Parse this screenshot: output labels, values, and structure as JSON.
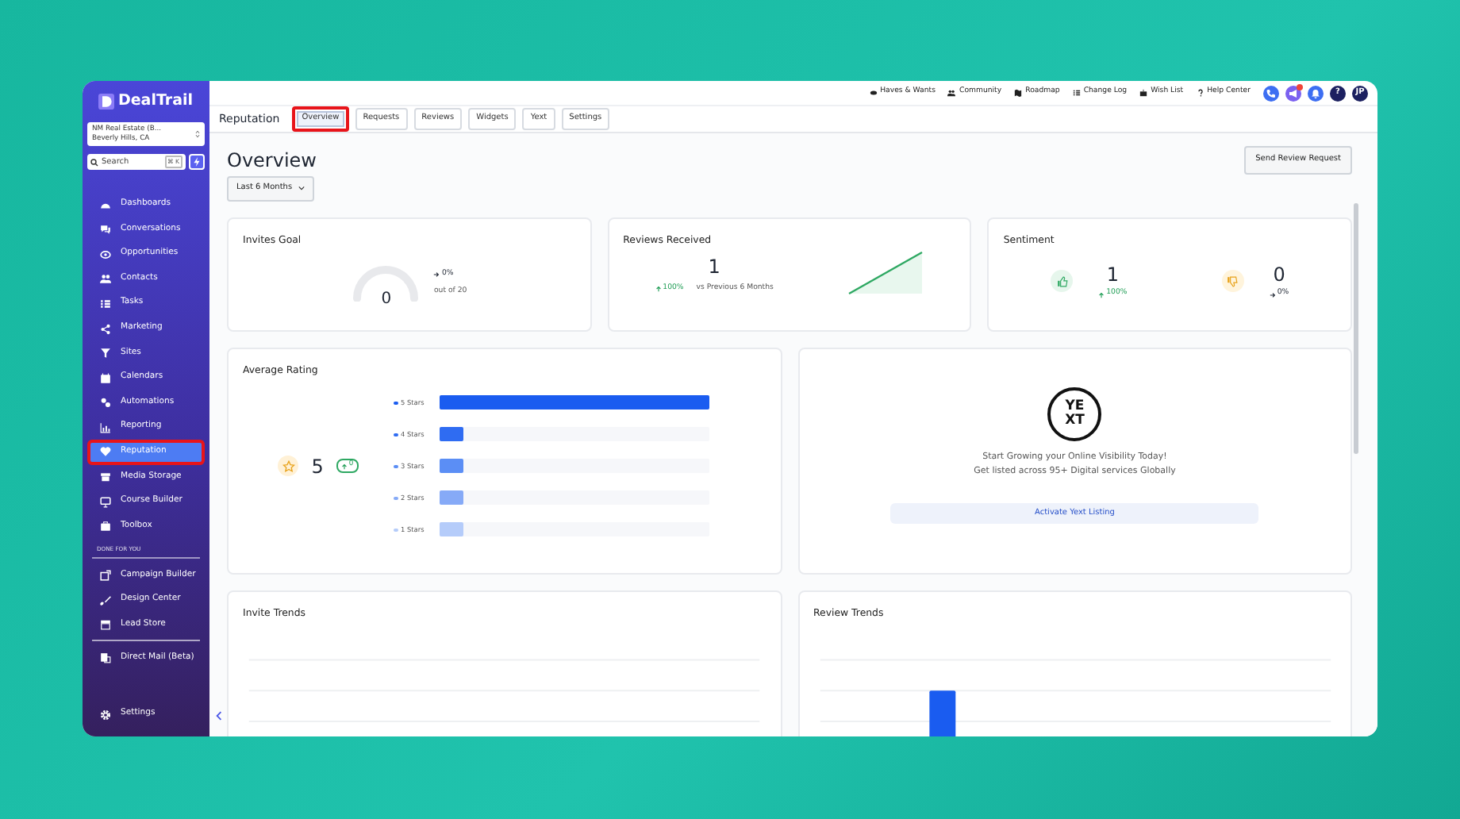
{
  "sidebar": {
    "brand": "DealTrail",
    "account": {
      "name": "NM Real Estate (B...",
      "location": "Beverly Hills, CA"
    },
    "search": {
      "placeholder": "Search",
      "shortcut": "⌘ K"
    },
    "nav_items": [
      {
        "label": "Dashboards",
        "selected": false,
        "highlighted": false
      },
      {
        "label": "Conversations",
        "selected": false,
        "highlighted": false
      },
      {
        "label": "Opportunities",
        "selected": false,
        "highlighted": false
      },
      {
        "label": "Contacts",
        "selected": false,
        "highlighted": false
      },
      {
        "label": "Tasks",
        "selected": false,
        "highlighted": false
      },
      {
        "label": "Marketing",
        "selected": false,
        "highlighted": false
      },
      {
        "label": "Sites",
        "selected": false,
        "highlighted": false
      },
      {
        "label": "Calendars",
        "selected": false,
        "highlighted": false
      },
      {
        "label": "Automations",
        "selected": false,
        "highlighted": false
      },
      {
        "label": "Reporting",
        "selected": false,
        "highlighted": false
      },
      {
        "label": "Reputation",
        "selected": true,
        "highlighted": true
      },
      {
        "label": "Media Storage",
        "selected": false,
        "highlighted": false
      },
      {
        "label": "Course Builder",
        "selected": false,
        "highlighted": false
      },
      {
        "label": "Toolbox",
        "selected": false,
        "highlighted": false
      }
    ],
    "section": {
      "title": "DONE FOR YOU",
      "items": [
        {
          "label": "Campaign Builder",
          "selected": false
        },
        {
          "label": "Design Center",
          "selected": false
        },
        {
          "label": "Lead Store",
          "selected": false
        }
      ]
    },
    "extra_items": [
      {
        "label": "Direct Mail (Beta)",
        "selected": false
      }
    ],
    "settings": {
      "label": "Settings"
    }
  },
  "top_links": [
    "Haves & Wants",
    "Community",
    "Roadmap",
    "Change Log",
    "Wish List",
    "Help Center"
  ],
  "top_buttons": [
    {
      "kind": "phone",
      "badge": false
    },
    {
      "kind": "megaphone",
      "badge": true
    },
    {
      "kind": "bell",
      "badge": false
    },
    {
      "kind": "help",
      "text": "?",
      "badge": false
    },
    {
      "kind": "avatar",
      "text": "JP",
      "badge": false
    }
  ],
  "page_title": "Reputation",
  "tabs": [
    {
      "label": "Overview",
      "selected": true,
      "highlighted": true
    },
    {
      "label": "Requests",
      "selected": false,
      "highlighted": false
    },
    {
      "label": "Reviews",
      "selected": false,
      "highlighted": false
    },
    {
      "label": "Widgets",
      "selected": false,
      "highlighted": false
    },
    {
      "label": "Yext",
      "selected": false,
      "highlighted": false
    },
    {
      "label": "Settings",
      "selected": false,
      "highlighted": false
    }
  ],
  "overview": {
    "title": "Overview",
    "period": "Last 6 Months",
    "action": "Send Review Request"
  },
  "invites_goal": {
    "title": "Invites Goal",
    "value": "0",
    "change": "0%",
    "goal": "out of 20"
  },
  "reviews_received": {
    "title": "Reviews Received",
    "value": "1",
    "change": "100%",
    "comparison": "vs Previous 6 Months"
  },
  "sentiment": {
    "title": "Sentiment",
    "positive": {
      "value": "1",
      "change": "100%"
    },
    "negative": {
      "value": "0",
      "change": "0%"
    }
  },
  "average_rating": {
    "title": "Average Rating",
    "value": "5",
    "change": "0",
    "rows": [
      {
        "label": "5 Stars",
        "level": 1,
        "color": "#1a5cf0"
      },
      {
        "label": "4 Stars",
        "level": 0.09,
        "color": "#2f6cf2"
      },
      {
        "label": "3 Stars",
        "level": 0.09,
        "color": "#5b8ef5"
      },
      {
        "label": "2 Stars",
        "level": 0.09,
        "color": "#86aaf7"
      },
      {
        "label": "1 Stars",
        "level": 0.09,
        "color": "#b5ccfa"
      }
    ]
  },
  "yext": {
    "logo_top": "YE",
    "logo_bottom": "XT",
    "line_1": "Start Growing your Online Visibility Today!",
    "line_2": "Get listed across 95+ Digital services Globally",
    "button": "Activate Yext Listing"
  },
  "invite_trends": {
    "title": "Invite Trends"
  },
  "review_trends": {
    "title": "Review Trends"
  }
}
